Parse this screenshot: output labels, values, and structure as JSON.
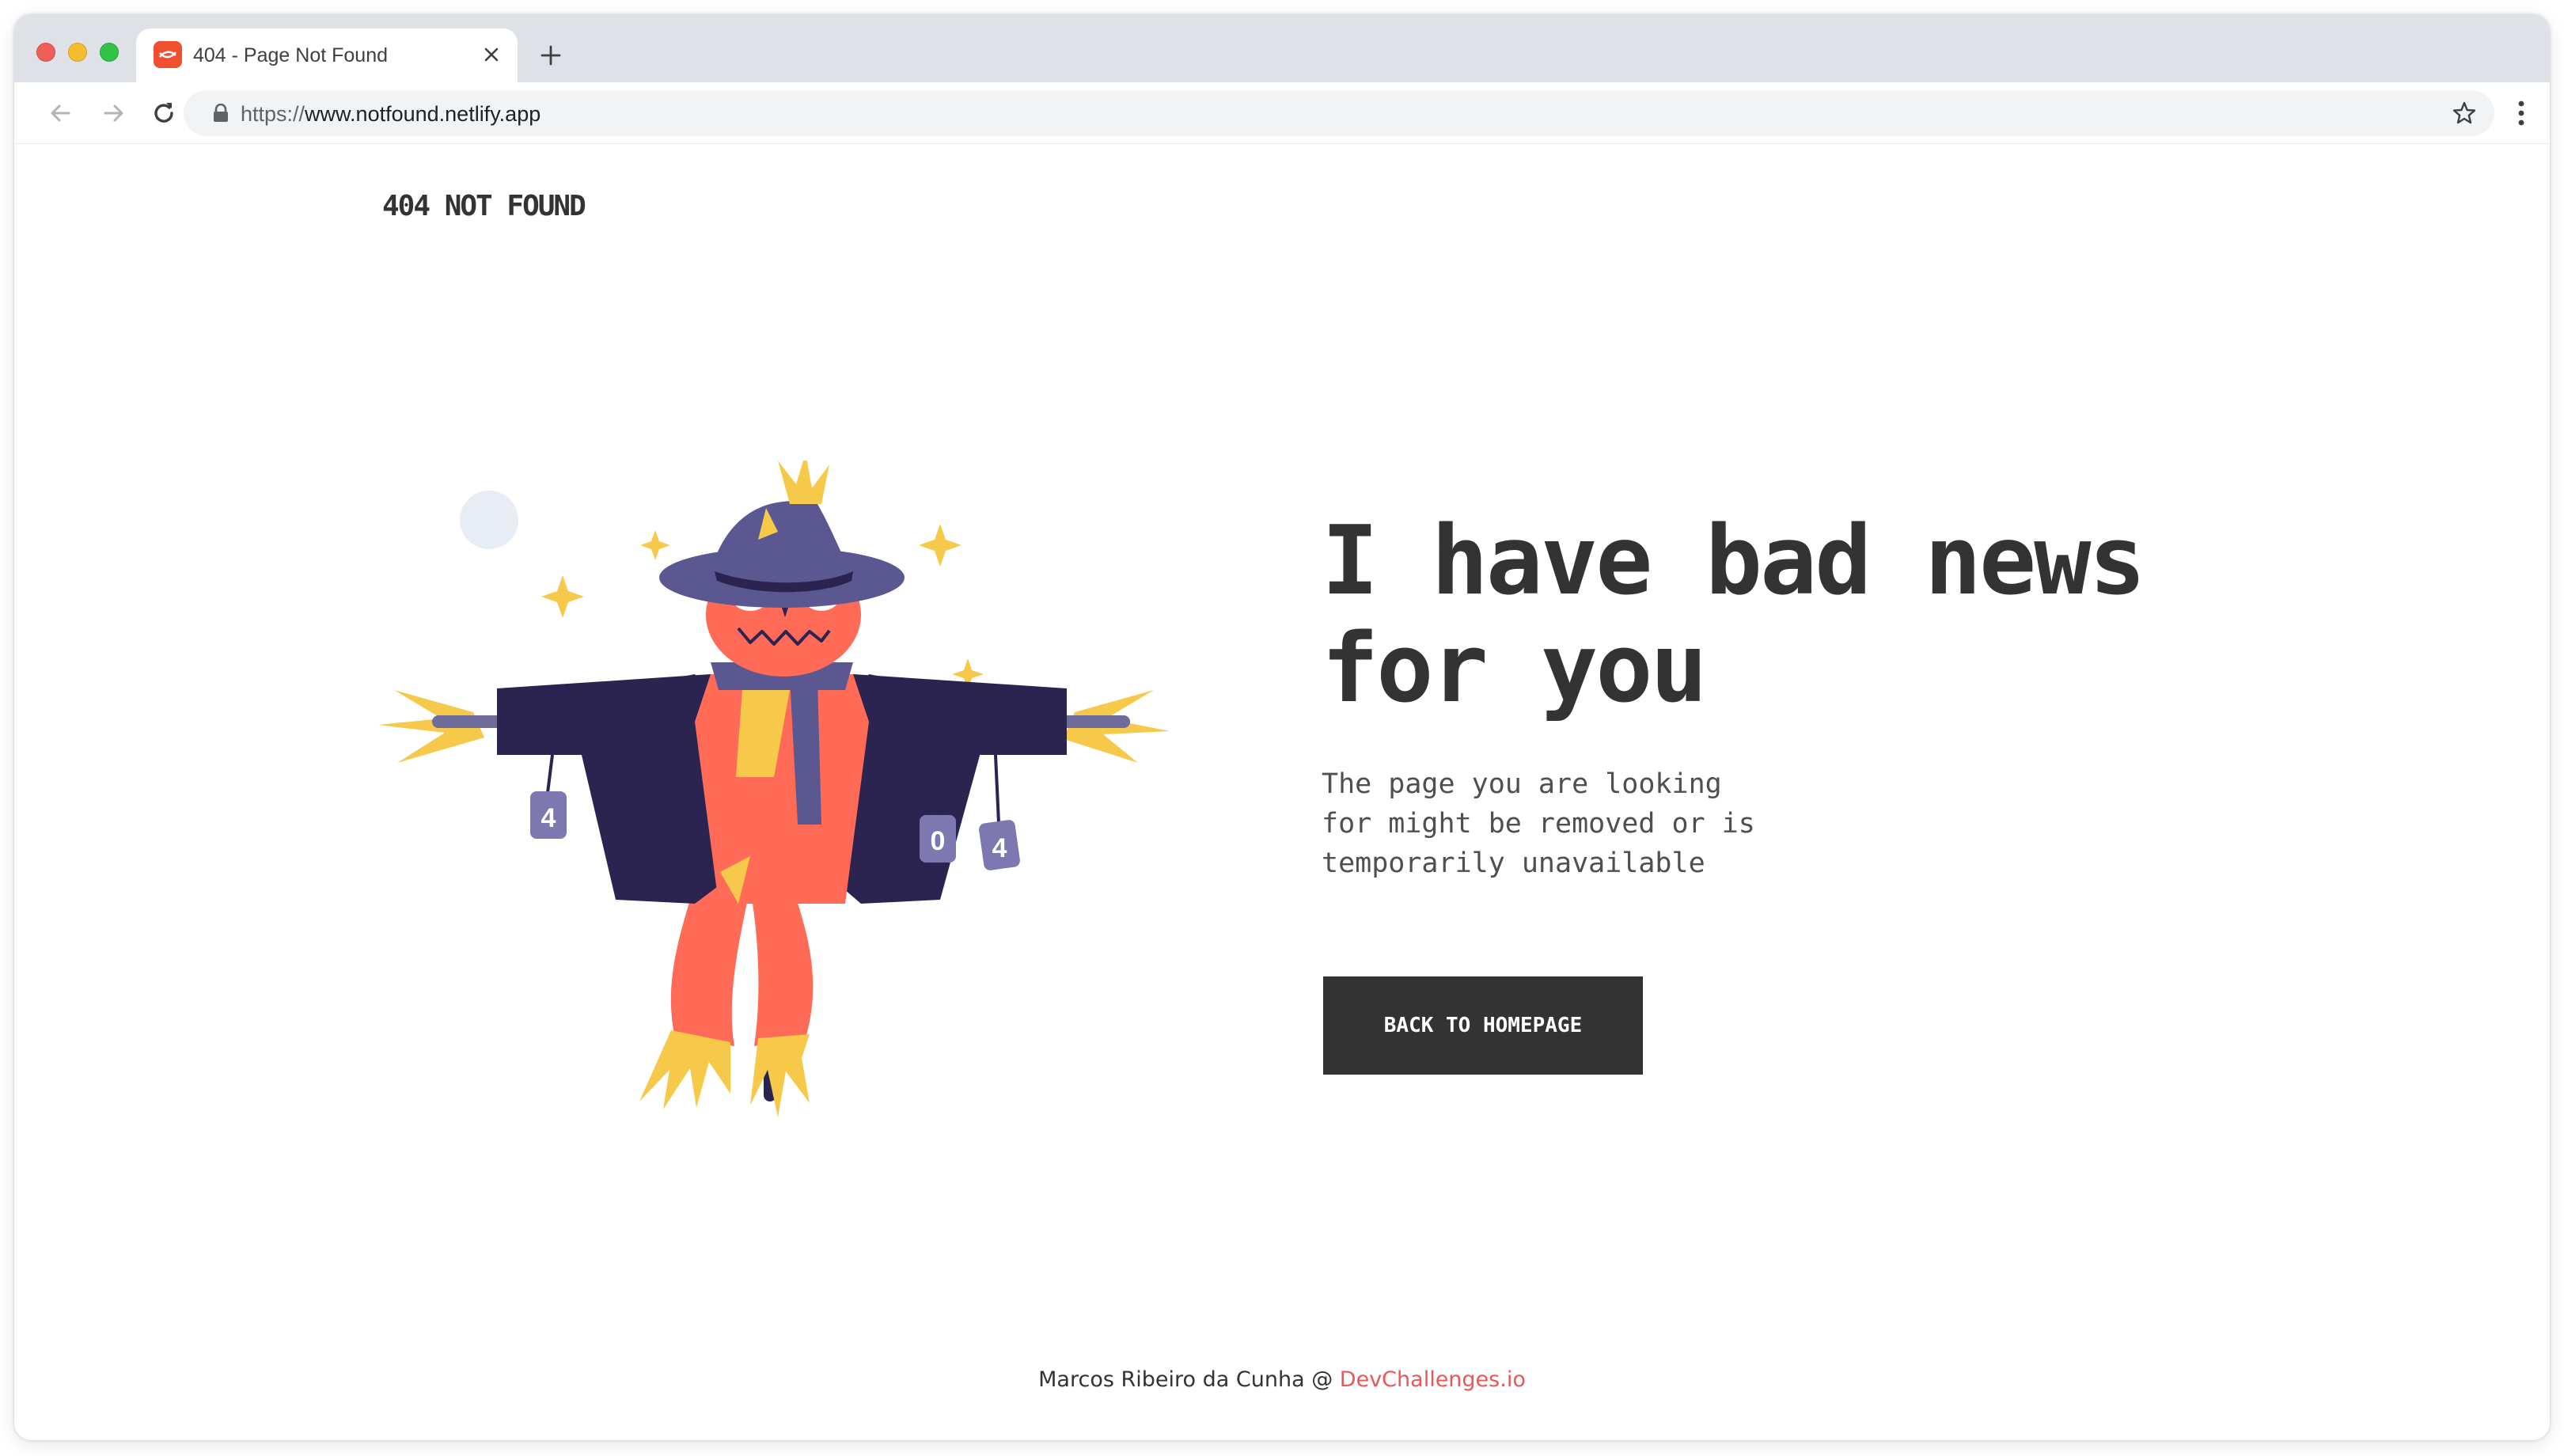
{
  "browser": {
    "tab": {
      "title": "404 - Page Not Found"
    },
    "address_bar": {
      "scheme": "https://",
      "host": "www.notfound.netlify.app"
    }
  },
  "page": {
    "brand": "404 NOT FOUND",
    "headline_line1": "I have bad news",
    "headline_line2": "for you",
    "description_line1": "The page you are looking",
    "description_line2": "for might be removed or is",
    "description_line3": "temporarily unavailable",
    "cta_label": "BACK TO HOMEPAGE",
    "illustration": {
      "can_labels": [
        "4",
        "0",
        "4"
      ]
    },
    "footer": {
      "author": "Marcos Ribeiro da Cunha @ ",
      "link": "DevChallenges.io"
    }
  },
  "colors": {
    "text_dark": "#333333",
    "text_muted": "#4F4F4F",
    "link": "#EB5757",
    "button_bg": "#333333",
    "tabstrip_bg": "#DEE1E6"
  }
}
